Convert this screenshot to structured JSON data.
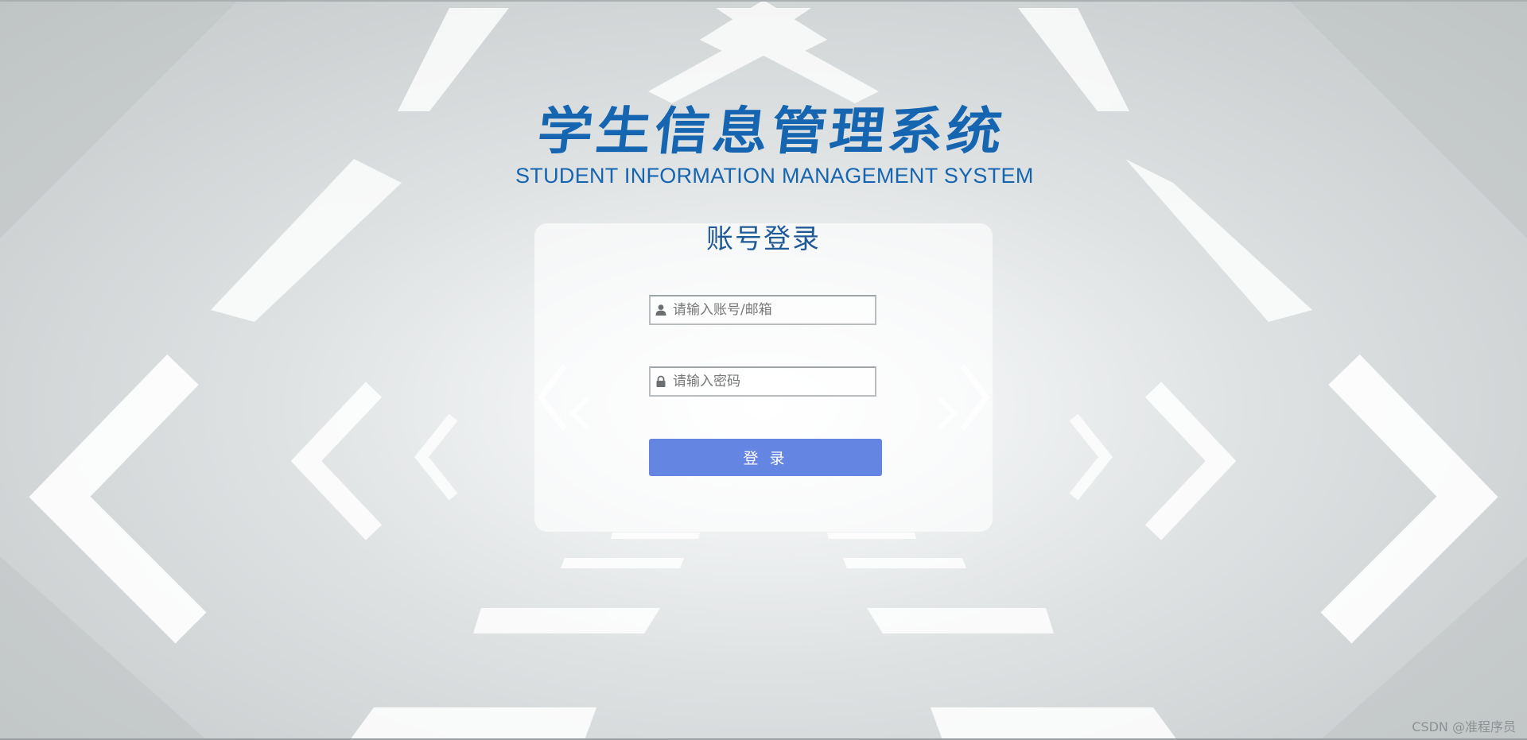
{
  "header": {
    "title_cn": "学生信息管理系统",
    "title_en": "STUDENT INFORMATION MANAGEMENT SYSTEM"
  },
  "login": {
    "title": "账号登录",
    "account_field": {
      "value": "",
      "placeholder": "请输入账号/邮箱",
      "icon": "user-icon"
    },
    "password_field": {
      "value": "",
      "placeholder": "请输入密码",
      "icon": "lock-icon"
    },
    "submit_label": "登 录"
  },
  "footer": {
    "watermark": "CSDN @准程序员"
  },
  "colors": {
    "brand": "#1565b0",
    "button": "#6585e3",
    "login_title": "#1f5a96"
  }
}
